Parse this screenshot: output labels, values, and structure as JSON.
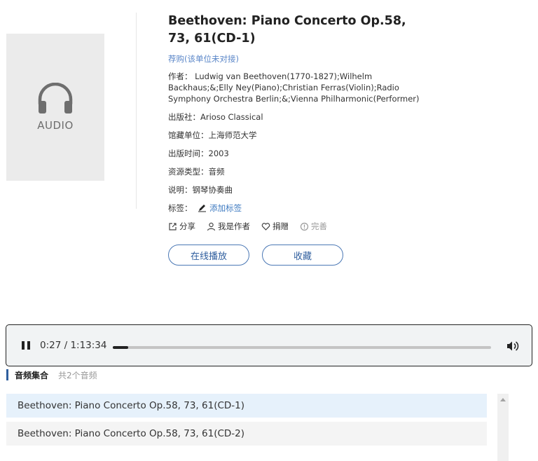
{
  "cover": {
    "icon": "headphones-icon",
    "label": "AUDIO"
  },
  "title": "Beethoven: Piano Concerto Op.58, 73, 61(CD-1)",
  "subscribe": "荐购(该单位未对接)",
  "author": "作者： Ludwig van Beethoven(1770-1827);Wilhelm Backhaus;&;Elly Ney(Piano);Christian Ferras(Violin);Radio Symphony Orchestra Berlin;&;Vienna Philharmonic(Performer)",
  "meta": [
    {
      "key": "出版社：",
      "value": "Arioso Classical"
    },
    {
      "key": "馆藏单位：",
      "value": "上海师范大学"
    },
    {
      "key": "出版时间：",
      "value": "2003"
    },
    {
      "key": "资源类型：",
      "value": "音频"
    },
    {
      "key": "说明：",
      "value": "钢琴协奏曲"
    }
  ],
  "tags": {
    "key": "标签：",
    "add_label": "添加标签"
  },
  "actions": {
    "share": "分享",
    "claim": "我是作者",
    "donate": "捐赠",
    "complete": "完善"
  },
  "buttons": {
    "play": "在线播放",
    "collect": "收藏"
  },
  "player": {
    "time": "0:27 / 1:13:34",
    "progress_fraction": 0.006
  },
  "collection": {
    "title": "音频集合",
    "count": "共2个音频"
  },
  "tracks": [
    "Beethoven: Piano Concerto Op.58, 73, 61(CD-1)",
    "Beethoven: Piano Concerto Op.58, 73, 61(CD-2)"
  ],
  "colors": {
    "accent": "#2f5e9e",
    "link": "#5a86c8",
    "active_row": "#e6f1fb"
  }
}
